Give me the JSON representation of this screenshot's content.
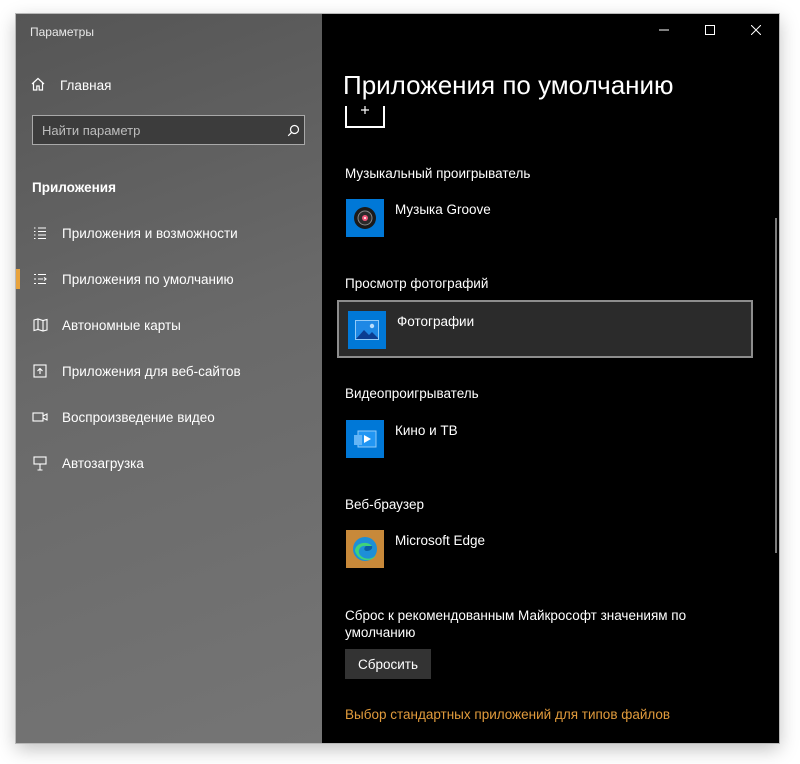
{
  "window": {
    "title": "Параметры"
  },
  "sidebar": {
    "home_label": "Главная",
    "search_placeholder": "Найти параметр",
    "section_title": "Приложения",
    "items": [
      {
        "label": "Приложения и возможности",
        "icon": "apps-list-icon",
        "active": false
      },
      {
        "label": "Приложения по умолчанию",
        "icon": "default-apps-icon",
        "active": true
      },
      {
        "label": "Автономные карты",
        "icon": "map-icon",
        "active": false
      },
      {
        "label": "Приложения для веб-сайтов",
        "icon": "web-app-icon",
        "active": false
      },
      {
        "label": "Воспроизведение видео",
        "icon": "video-icon",
        "active": false
      },
      {
        "label": "Автозагрузка",
        "icon": "startup-icon",
        "active": false
      }
    ],
    "accent_color": "#e8a33d"
  },
  "main": {
    "title": "Приложения по умолчанию",
    "categories": [
      {
        "label": "Музыкальный проигрыватель",
        "app": "Музыка Groove",
        "icon": "groove-music-icon"
      },
      {
        "label": "Просмотр фотографий",
        "app": "Фотографии",
        "icon": "photos-icon"
      },
      {
        "label": "Видеопроигрыватель",
        "app": "Кино и ТВ",
        "icon": "movies-tv-icon"
      },
      {
        "label": "Веб-браузер",
        "app": "Microsoft Edge",
        "icon": "edge-icon"
      }
    ],
    "reset_description": "Сброс к рекомендованным Майкрософт значениям по умолчанию",
    "reset_button": "Сбросить",
    "file_types_link": "Выбор стандартных приложений для типов файлов",
    "link_color": "#e19b3c"
  }
}
